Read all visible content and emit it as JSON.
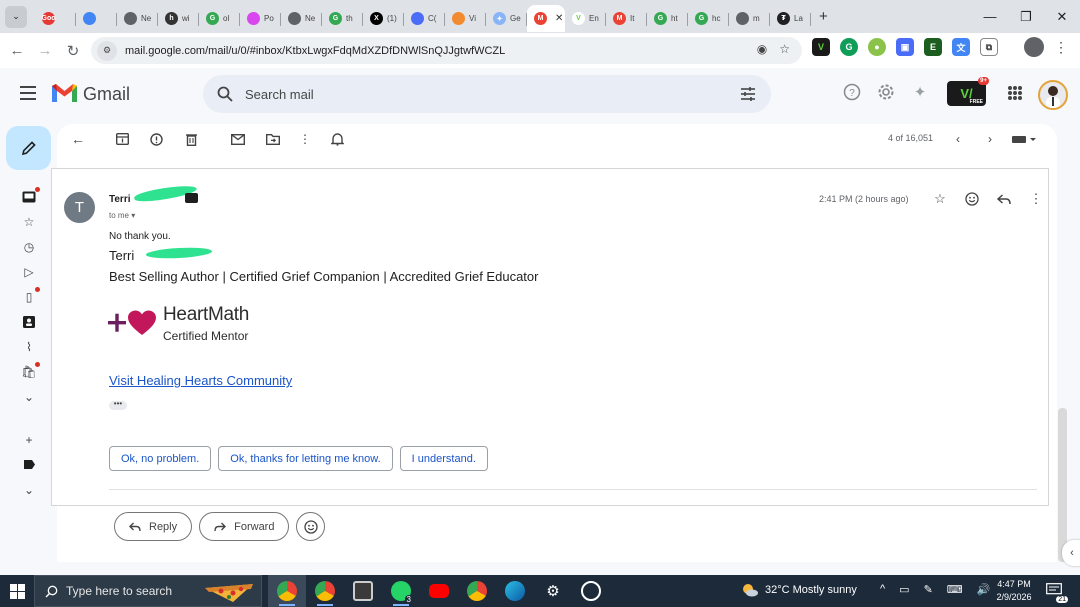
{
  "browser": {
    "tabs": [
      {
        "label": "",
        "color": "#e53935",
        "glyph": "Goo"
      },
      {
        "label": "",
        "color": "#4285f4",
        "glyph": ""
      },
      {
        "label": "Ne",
        "color": "#5f6368",
        "glyph": ""
      },
      {
        "label": "wi",
        "color": "#333333",
        "glyph": "h"
      },
      {
        "label": "ol",
        "color": "#34a853",
        "glyph": "G"
      },
      {
        "label": "Po",
        "color": "#d946ef",
        "glyph": ""
      },
      {
        "label": "Ne",
        "color": "#5f6368",
        "glyph": ""
      },
      {
        "label": "th",
        "color": "#34a853",
        "glyph": "G"
      },
      {
        "label": "(1)",
        "color": "#000000",
        "glyph": "X"
      },
      {
        "label": "C(",
        "color": "#4a6cf7",
        "glyph": ""
      },
      {
        "label": "Vi",
        "color": "#f28b30",
        "glyph": ""
      },
      {
        "label": "Ge",
        "color": "#8ab4f8",
        "glyph": "✦"
      },
      {
        "label": "",
        "color": "#ea4335",
        "glyph": "M",
        "active": true
      },
      {
        "label": "En",
        "color": "#ffffff",
        "glyph": "V"
      },
      {
        "label": "It",
        "color": "#ea4335",
        "glyph": "M"
      },
      {
        "label": "ht",
        "color": "#34a853",
        "glyph": "G"
      },
      {
        "label": "hc",
        "color": "#34a853",
        "glyph": "G"
      },
      {
        "label": "m",
        "color": "#5f6368",
        "glyph": ""
      },
      {
        "label": "La",
        "color": "#202124",
        "glyph": "₮"
      }
    ],
    "url": "mail.google.com/mail/u/0/#inbox/KtbxLwgxFdqMdXZDfDNWlSnQJJgtwfWCZL"
  },
  "gmail": {
    "brand": "Gmail",
    "search_placeholder": "Search mail",
    "extension_badge": {
      "count": "9+",
      "label": "FREE"
    },
    "pager": "4 of 16,051"
  },
  "message": {
    "avatar_letter": "T",
    "sender": "Terri",
    "to": "to me",
    "timestamp": "2:41 PM (2 hours ago)",
    "body": "No thank you.",
    "signature_name": "Terri",
    "signature_title": "Best Selling Author | Certified Grief Companion | Accredited Grief Educator",
    "heartmath_word": "HeartMath",
    "heartmath_sub": "Certified Mentor",
    "link": "Visit Healing Hearts Community",
    "trimmed": "•••",
    "smart_replies": [
      "Ok, no problem.",
      "Ok, thanks for letting me know.",
      "I understand."
    ],
    "reply_label": "Reply",
    "forward_label": "Forward"
  },
  "taskbar": {
    "search_text": "Type here to search",
    "weather": "32°C  Mostly sunny",
    "time": "4:47 PM",
    "date": "2/9/2026",
    "whatsapp_badge": "3",
    "notif_count": "21"
  },
  "colors": {
    "gmail_red": "#ea4335",
    "link_blue": "#1a55c9",
    "compose_blue": "#c2e7ff",
    "heartmath_purple": "#6b1f5e",
    "heartmath_pink": "#c2185b",
    "redaction_green": "#2ee28f"
  }
}
